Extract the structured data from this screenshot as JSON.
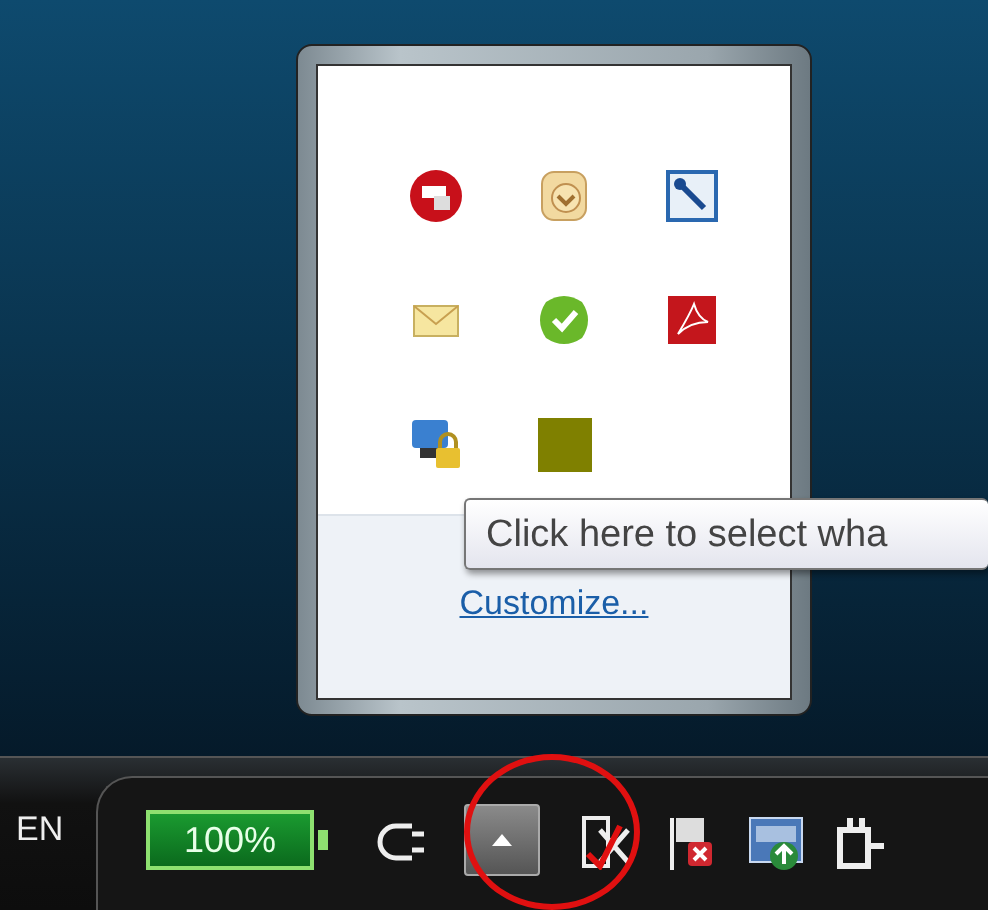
{
  "overflow_panel": {
    "icons": [
      {
        "kind": "red-disc"
      },
      {
        "kind": "clock-badge"
      },
      {
        "kind": "wrench"
      },
      {
        "kind": "envelope"
      },
      {
        "kind": "green-check"
      },
      {
        "kind": "pdf"
      },
      {
        "kind": "computer-lock"
      },
      {
        "kind": "square"
      }
    ],
    "link": "Customize..."
  },
  "tooltip": "Click here to select wha",
  "taskbar": {
    "language": "EN",
    "battery": {
      "reading": "100%",
      "level": 1
    },
    "tray": [
      {
        "kind": "plug"
      },
      {
        "kind": "expand-button"
      },
      {
        "kind": "screen-x"
      },
      {
        "kind": "flag-x"
      },
      {
        "kind": "network-up"
      },
      {
        "kind": "power"
      }
    ]
  }
}
